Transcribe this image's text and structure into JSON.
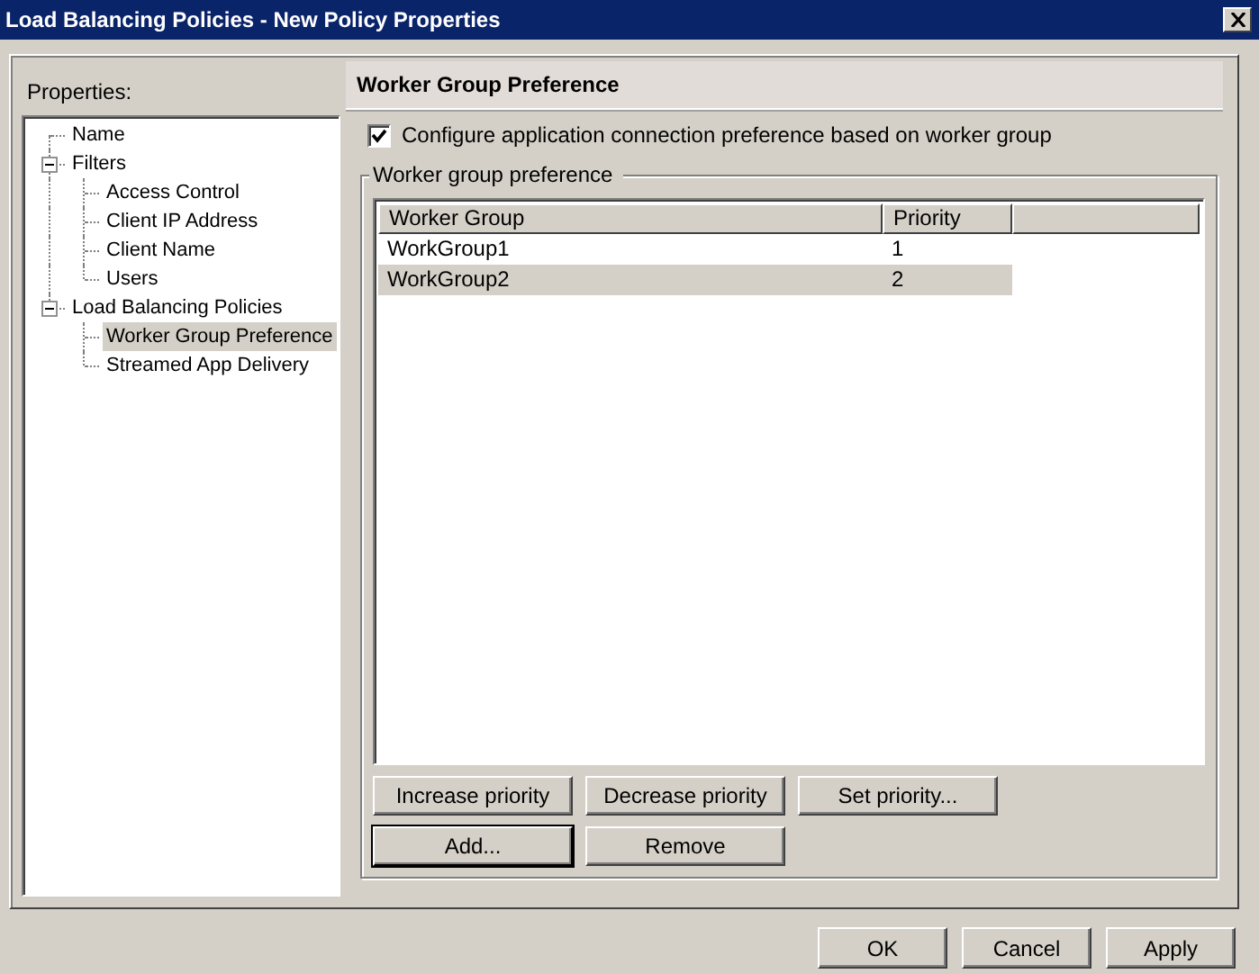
{
  "window": {
    "title": "Load Balancing Policies - New Policy Properties"
  },
  "properties_label": "Properties:",
  "tree": [
    {
      "label": "Name",
      "selected": false
    },
    {
      "label": "Filters",
      "selected": false,
      "expanded": true,
      "children": [
        {
          "label": "Access Control",
          "selected": false
        },
        {
          "label": "Client IP Address",
          "selected": false
        },
        {
          "label": "Client Name",
          "selected": false
        },
        {
          "label": "Users",
          "selected": false
        }
      ]
    },
    {
      "label": "Load Balancing Policies",
      "selected": false,
      "expanded": true,
      "children": [
        {
          "label": "Worker Group Preference",
          "selected": true
        },
        {
          "label": "Streamed App Delivery",
          "selected": false
        }
      ]
    }
  ],
  "page": {
    "title": "Worker Group Preference",
    "checkbox": {
      "label": "Configure application connection preference based on worker group",
      "checked": true
    },
    "group": {
      "title": "Worker group preference",
      "columns": [
        "Worker Group",
        "Priority"
      ],
      "rows": [
        {
          "cells": [
            "WorkGroup1",
            "1"
          ],
          "selected": false
        },
        {
          "cells": [
            "WorkGroup2",
            "2"
          ],
          "selected": true
        }
      ]
    },
    "button_rows": [
      [
        {
          "label": "Increase priority",
          "default": false
        },
        {
          "label": "Decrease priority",
          "default": false
        },
        {
          "label": "Set priority...",
          "default": false
        }
      ],
      [
        {
          "label": "Add...",
          "default": true
        },
        {
          "label": "Remove",
          "default": false
        }
      ]
    ]
  },
  "footer_buttons": [
    "OK",
    "Cancel",
    "Apply"
  ]
}
